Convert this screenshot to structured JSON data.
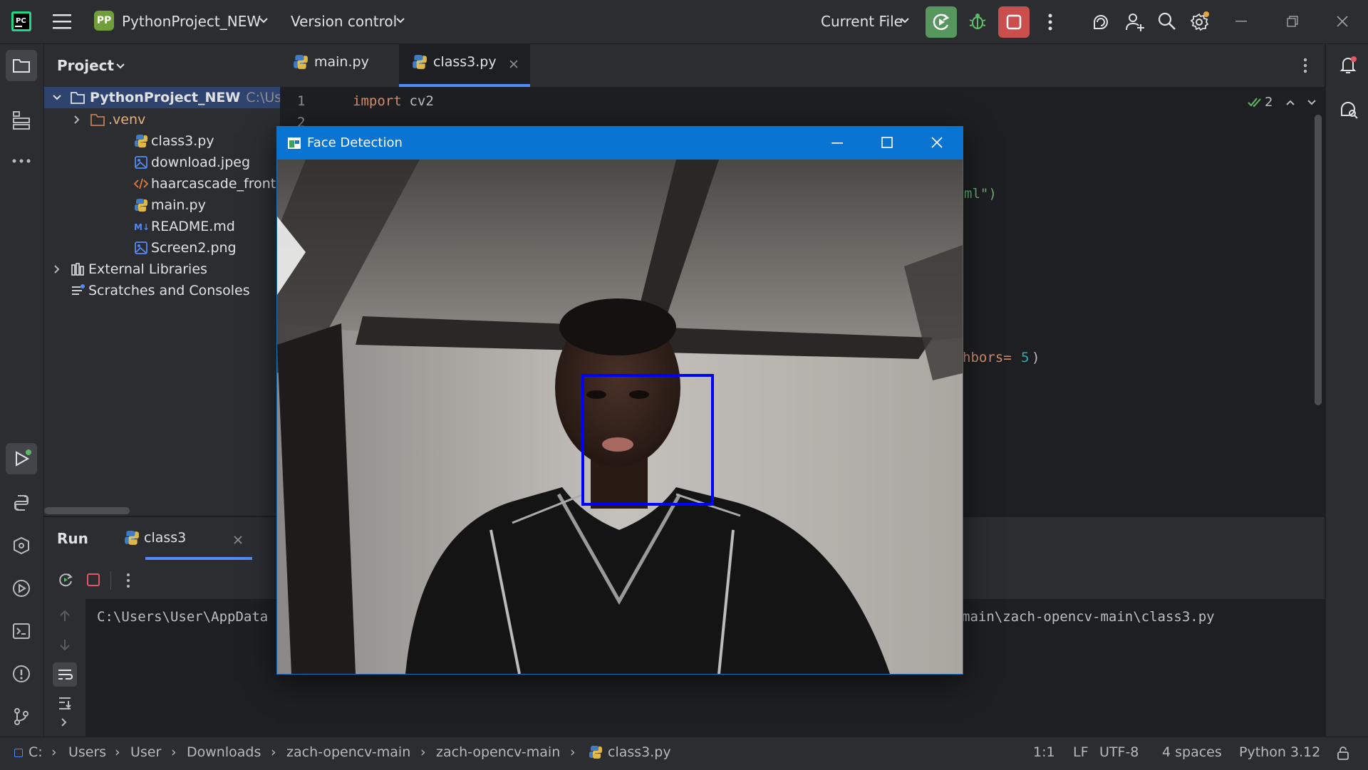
{
  "titlebar": {
    "project_badge": "PP",
    "project_name": "PythonProject_NEW",
    "version_control": "Version control",
    "run_config": "Current File"
  },
  "project_panel": {
    "title": "Project",
    "root": "PythonProject_NEW",
    "root_path": "C:\\Use",
    "items": [
      {
        "label": ".venv",
        "type": "folder"
      },
      {
        "label": "class3.py",
        "type": "python"
      },
      {
        "label": "download.jpeg",
        "type": "image"
      },
      {
        "label": "haarcascade_frontalface_",
        "type": "xml"
      },
      {
        "label": "main.py",
        "type": "python"
      },
      {
        "label": "README.md",
        "type": "markdown"
      },
      {
        "label": "Screen2.png",
        "type": "image"
      }
    ],
    "external_libraries": "External Libraries",
    "scratches": "Scratches and Consoles"
  },
  "editor": {
    "tabs": [
      {
        "label": "main.py"
      },
      {
        "label": "class3.py"
      }
    ],
    "line_numbers": [
      "1",
      "2"
    ],
    "code_keyword": "import",
    "code_module": " cv2",
    "code_fragment_1": "ml\")",
    "code_fragment_2a": "hbors= ",
    "code_fragment_2b": "5",
    "code_fragment_2c": ")",
    "inspections_count": "2"
  },
  "face_window": {
    "title": "Face Detection"
  },
  "run_panel": {
    "title": "Run",
    "tab_label": "class3",
    "console_left": "C:\\Users\\User\\AppData",
    "console_right": "main\\zach-opencv-main\\class3.py"
  },
  "statusbar": {
    "breadcrumbs": [
      "C:",
      "Users",
      "User",
      "Downloads",
      "zach-opencv-main",
      "zach-opencv-main",
      "class3.py"
    ],
    "position": "1:1",
    "line_sep": "LF",
    "encoding": "UTF-8",
    "indent": "4 spaces",
    "interpreter": "Python 3.12"
  },
  "colors": {
    "accent_blue": "#0a74d3",
    "run_green": "#57965c",
    "stop_red": "#c94f4f",
    "keyword_orange": "#cf8e6d",
    "number_blue": "#2aacb8",
    "string_green": "#6aab73"
  }
}
